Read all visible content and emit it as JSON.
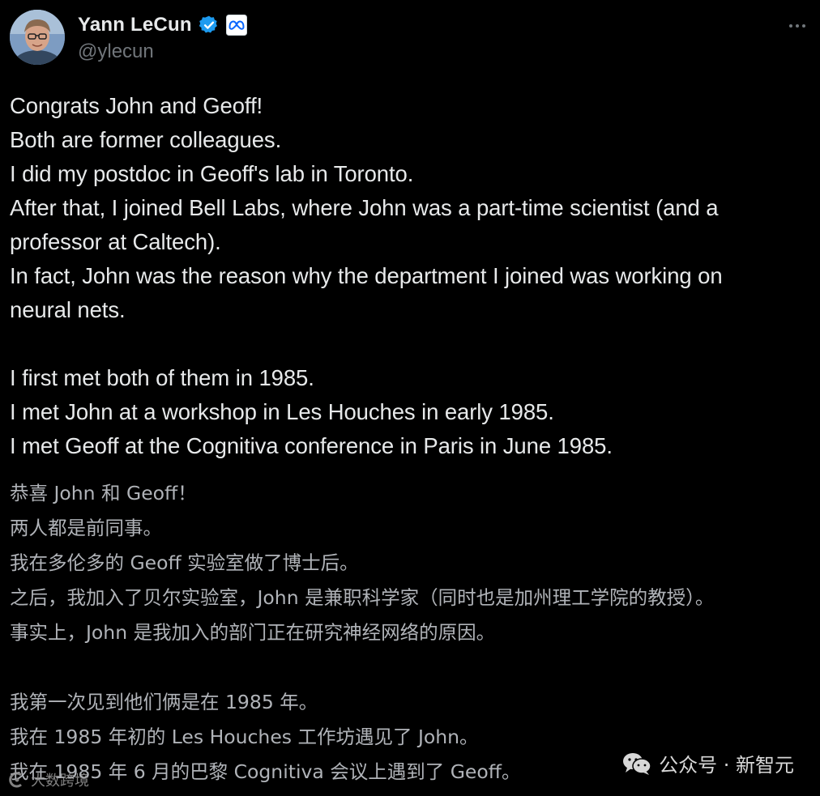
{
  "author": {
    "display_name": "Yann LeCun",
    "handle": "@ylecun",
    "verified_icon": "verified-badge-icon",
    "affiliation_icon": "meta-logo-icon",
    "avatar_icon": "profile-photo"
  },
  "menu": {
    "more_icon": "more-horizontal-icon"
  },
  "tweet": {
    "lines": [
      "Congrats John and Geoff!",
      "Both are former colleagues.",
      "I did my postdoc in Geoff's lab in Toronto.",
      "After that, I joined Bell Labs, where John was a part-time scientist (and a",
      "professor at Caltech).",
      "In fact, John was the reason why the department I joined was working on",
      "neural nets.",
      "",
      "I first met both of them in 1985.",
      "I met John at a workshop in Les Houches in early 1985.",
      "I met Geoff at the Cognitiva conference in Paris in June 1985."
    ]
  },
  "translation": {
    "lines": [
      "恭喜 John 和 Geoff！",
      "两人都是前同事。",
      "我在多伦多的 Geoff 实验室做了博士后。",
      "之后，我加入了贝尔实验室，John 是兼职科学家（同时也是加州理工学院的教授）。",
      "事实上，John 是我加入的部门正在研究神经网络的原因。",
      "",
      "我第一次见到他们俩是在 1985 年。",
      "我在 1985 年初的 Les Houches 工作坊遇见了 John。",
      "我在 1985 年 6 月的巴黎 Cognitiva 会议上遇到了 Geoff。"
    ]
  },
  "watermarks": {
    "right": "公众号 · 新智元",
    "right_icon": "wechat-icon",
    "left": "大数跨境",
    "left_icon": "brand-mark-icon"
  },
  "colors": {
    "background": "#000000",
    "text": "#e7e9ea",
    "secondary": "#71767b",
    "verified": "#1d9bf0"
  }
}
